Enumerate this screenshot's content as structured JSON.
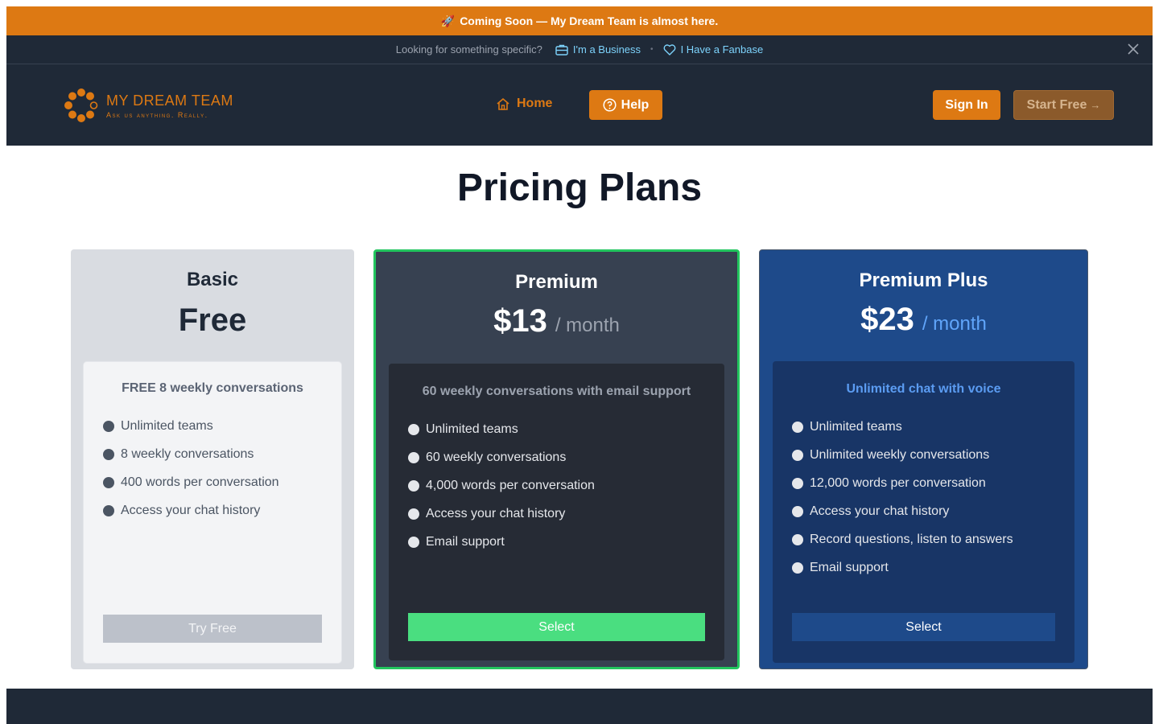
{
  "announcement": {
    "icon": "rocket-icon",
    "text": "Coming Soon — My Dream Team is almost here."
  },
  "subbar": {
    "question": "Looking for something specific?",
    "business_label": "I'm a Business",
    "fanbase_label": "I Have a Fanbase"
  },
  "header": {
    "logo_name": "MY DREAM TEAM",
    "logo_tagline": "Ask us anything. Really.",
    "home_label": "Home",
    "help_label": "Help",
    "signin_label": "Sign In",
    "start_label": "Start Free",
    "start_arrow": "→"
  },
  "page": {
    "title": "Pricing Plans"
  },
  "plans": [
    {
      "name": "Basic",
      "price": "Free",
      "period": "",
      "headline": "FREE 8 weekly conversations",
      "features": [
        "Unlimited teams",
        "8 weekly conversations",
        "400 words per conversation",
        "Access your chat history"
      ],
      "cta": "Try Free"
    },
    {
      "name": "Premium",
      "price": "$13",
      "period": "/ month",
      "headline": "60 weekly conversations with email support",
      "features": [
        "Unlimited teams",
        "60 weekly conversations",
        "4,000 words per conversation",
        "Access your chat history",
        "Email support"
      ],
      "cta": "Select"
    },
    {
      "name": "Premium Plus",
      "price": "$23",
      "period": "/ month",
      "headline": "Unlimited chat with voice",
      "features": [
        "Unlimited teams",
        "Unlimited weekly conversations",
        "12,000 words per conversation",
        "Access your chat history",
        "Record questions, listen to answers",
        "Email support"
      ],
      "cta": "Select"
    }
  ],
  "colors": {
    "brand_orange": "#dd7913",
    "header_bg": "#1f2937",
    "premium_border": "#22c55e",
    "premium_plus_bg": "#1e4a8a"
  }
}
